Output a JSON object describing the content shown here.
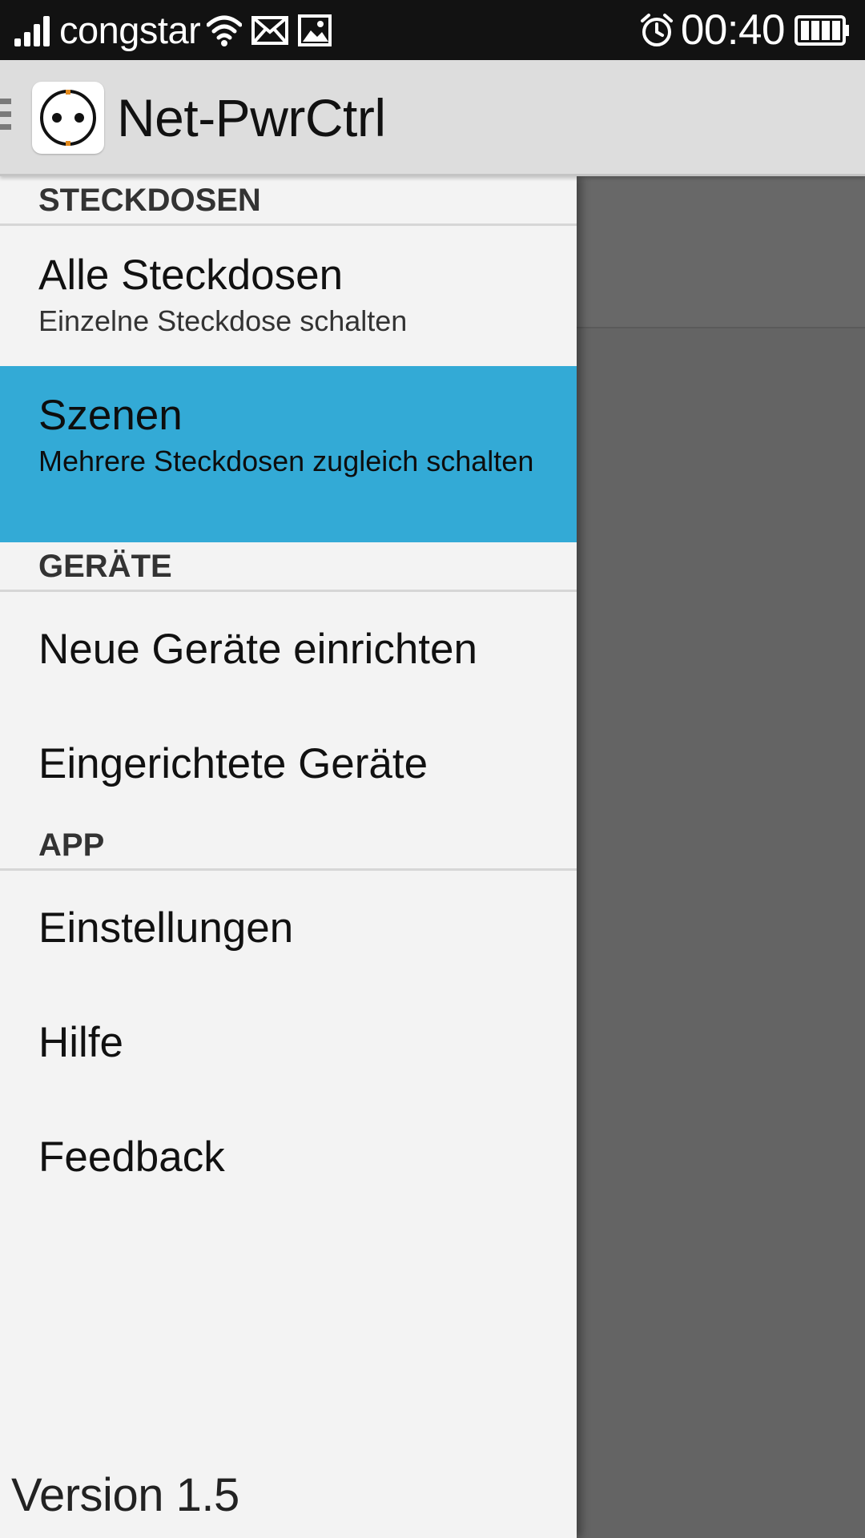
{
  "status_bar": {
    "carrier": "congstar",
    "time": "00:40",
    "icons": [
      "signal-icon",
      "wifi-icon",
      "mail-icon",
      "image-icon",
      "alarm-icon",
      "battery-icon"
    ]
  },
  "action_bar": {
    "title": "Net-PwrCtrl",
    "logo_icon": "power-socket-icon",
    "toggle_icon": "drawer-toggle-icon"
  },
  "drawer": {
    "sections": [
      {
        "header": "STECKDOSEN",
        "items": [
          {
            "label": "Alle Steckdosen",
            "sub": "Einzelne Steckdose schalten"
          },
          {
            "label": "Szenen",
            "sub": "Mehrere Steckdosen zugleich schalten",
            "selected": true
          }
        ]
      },
      {
        "header": "GERÄTE",
        "items": [
          {
            "label": "Neue Geräte einrichten"
          },
          {
            "label": "Eingerichtete Geräte"
          }
        ]
      },
      {
        "header": "APP",
        "items": [
          {
            "label": "Einstellungen"
          },
          {
            "label": "Hilfe"
          },
          {
            "label": "Feedback"
          }
        ]
      }
    ],
    "version": "Version 1.5"
  },
  "colors": {
    "status_bar": "#121212",
    "action_bar": "#dddddd",
    "drawer_bg": "#f3f3f3",
    "selected": "#33aad6",
    "scrim": "#646464"
  }
}
